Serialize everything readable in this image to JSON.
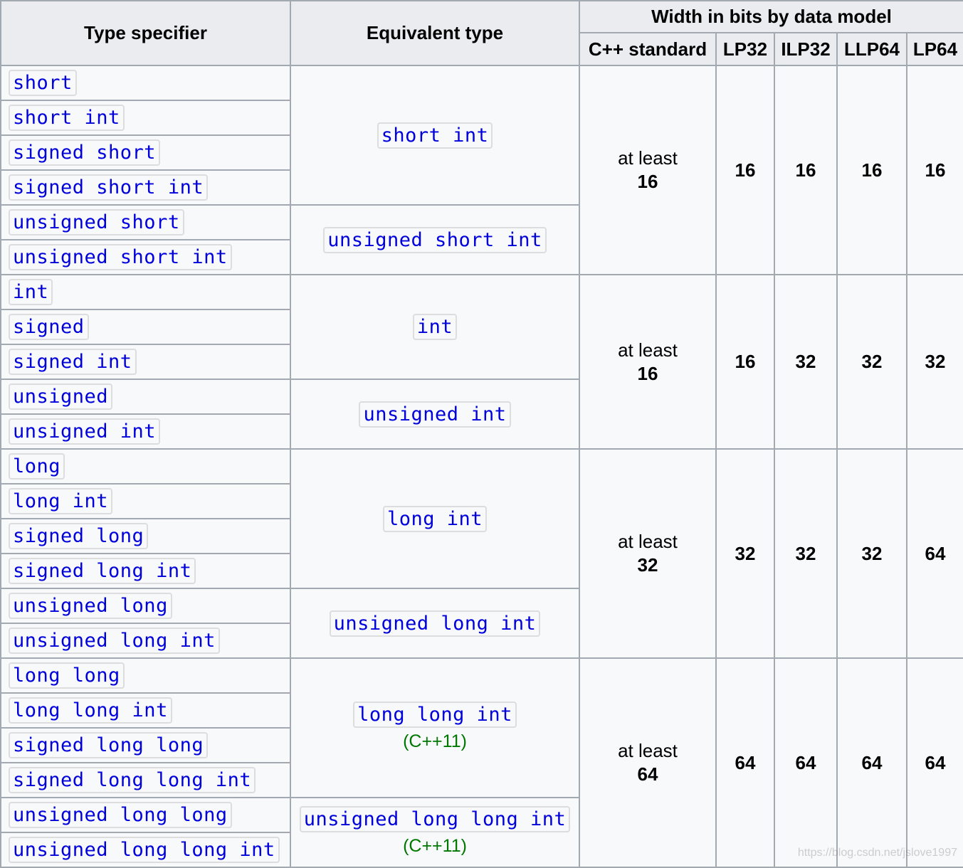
{
  "headers": {
    "type_specifier": "Type specifier",
    "equivalent_type": "Equivalent type",
    "width_group": "Width in bits by data model",
    "models": [
      "C++ standard",
      "LP32",
      "ILP32",
      "LLP64",
      "LP64"
    ]
  },
  "specifiers": [
    "short",
    "short int",
    "signed short",
    "signed short int",
    "unsigned short",
    "unsigned short int",
    "int",
    "signed",
    "signed int",
    "unsigned",
    "unsigned int",
    "long",
    "long int",
    "signed long",
    "signed long int",
    "unsigned long",
    "unsigned long int",
    "long long",
    "long long int",
    "signed long long",
    "signed long long int",
    "unsigned long long",
    "unsigned long long int"
  ],
  "equivalents": [
    {
      "type": "short int",
      "note": ""
    },
    {
      "type": "unsigned short int",
      "note": ""
    },
    {
      "type": "int",
      "note": ""
    },
    {
      "type": "unsigned int",
      "note": ""
    },
    {
      "type": "long int",
      "note": ""
    },
    {
      "type": "unsigned long int",
      "note": ""
    },
    {
      "type": "long long int",
      "note": "(C++11)"
    },
    {
      "type": "unsigned long long int",
      "note": "(C++11)"
    }
  ],
  "groups": [
    {
      "standard_prefix": "at least",
      "standard_value": "16",
      "lp32": "16",
      "ilp32": "16",
      "llp64": "16",
      "lp64": "16"
    },
    {
      "standard_prefix": "at least",
      "standard_value": "16",
      "lp32": "16",
      "ilp32": "32",
      "llp64": "32",
      "lp64": "32"
    },
    {
      "standard_prefix": "at least",
      "standard_value": "32",
      "lp32": "32",
      "ilp32": "32",
      "llp64": "32",
      "lp64": "64"
    },
    {
      "standard_prefix": "at least",
      "standard_value": "64",
      "lp32": "64",
      "ilp32": "64",
      "llp64": "64",
      "lp64": "64"
    }
  ],
  "watermark": "https://blog.csdn.net/jslove1997"
}
